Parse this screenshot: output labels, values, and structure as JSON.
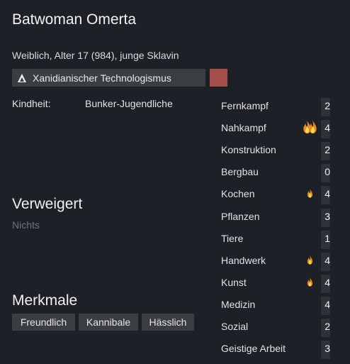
{
  "pawn": {
    "name": "Batwoman Omerta",
    "description": "Weiblich, Alter 17 (984), junge Sklavin",
    "faction_label": "Xanidianischer Technologismus",
    "faction_color": "#a44f4c"
  },
  "backstory": {
    "label": "Kindheit:",
    "value": "Bunker-Jugendliche"
  },
  "refused": {
    "title": "Verweigert",
    "value": "Nichts"
  },
  "traits": {
    "title": "Merkmale",
    "items": [
      "Freundlich",
      "Kannibale",
      "Hässlich"
    ]
  },
  "skills": [
    {
      "name": "Fernkampf",
      "level": "2",
      "passion": "none"
    },
    {
      "name": "Nahkampf",
      "level": "4",
      "passion": "major"
    },
    {
      "name": "Konstruktion",
      "level": "2",
      "passion": "none"
    },
    {
      "name": "Bergbau",
      "level": "0",
      "passion": "none"
    },
    {
      "name": "Kochen",
      "level": "4",
      "passion": "minor"
    },
    {
      "name": "Pflanzen",
      "level": "3",
      "passion": "none"
    },
    {
      "name": "Tiere",
      "level": "1",
      "passion": "none"
    },
    {
      "name": "Handwerk",
      "level": "4",
      "passion": "minor"
    },
    {
      "name": "Kunst",
      "level": "4",
      "passion": "minor"
    },
    {
      "name": "Medizin",
      "level": "4",
      "passion": "none"
    },
    {
      "name": "Sozial",
      "level": "2",
      "passion": "none"
    },
    {
      "name": "Geistige Arbeit",
      "level": "3",
      "passion": "none"
    }
  ],
  "icons": {
    "faction": "triangle-faction-icon",
    "passion_minor": "flame-icon",
    "passion_major": "double-flame-icon"
  }
}
